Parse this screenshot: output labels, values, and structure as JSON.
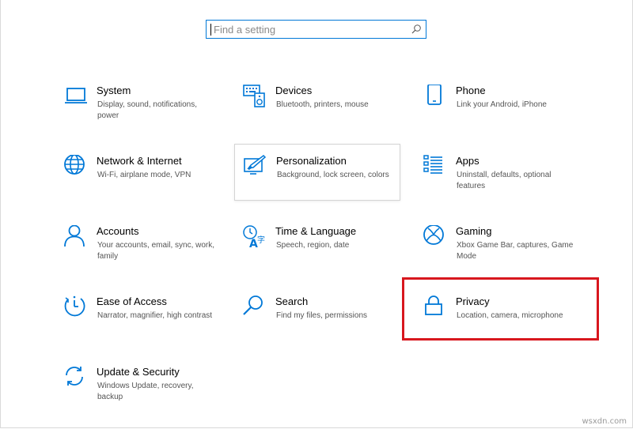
{
  "search": {
    "placeholder": "Find a setting"
  },
  "colors": {
    "accent": "#0078d7",
    "highlight": "#d8171e"
  },
  "tiles": [
    {
      "title": "System",
      "desc": "Display, sound, notifications, power",
      "icon": "laptop-icon"
    },
    {
      "title": "Devices",
      "desc": "Bluetooth, printers, mouse",
      "icon": "keyboard-speaker-icon"
    },
    {
      "title": "Phone",
      "desc": "Link your Android, iPhone",
      "icon": "phone-icon"
    },
    {
      "title": "Network & Internet",
      "desc": "Wi-Fi, airplane mode, VPN",
      "icon": "globe-icon"
    },
    {
      "title": "Personalization",
      "desc": "Background, lock screen, colors",
      "icon": "paintbrush-monitor-icon"
    },
    {
      "title": "Apps",
      "desc": "Uninstall, defaults, optional features",
      "icon": "list-icon"
    },
    {
      "title": "Accounts",
      "desc": "Your accounts, email, sync, work, family",
      "icon": "person-icon"
    },
    {
      "title": "Time & Language",
      "desc": "Speech, region, date",
      "icon": "time-language-icon"
    },
    {
      "title": "Gaming",
      "desc": "Xbox Game Bar, captures, Game Mode",
      "icon": "xbox-icon"
    },
    {
      "title": "Ease of Access",
      "desc": "Narrator, magnifier, high contrast",
      "icon": "ease-of-access-icon"
    },
    {
      "title": "Search",
      "desc": "Find my files, permissions",
      "icon": "magnifier-icon"
    },
    {
      "title": "Privacy",
      "desc": "Location, camera, microphone",
      "icon": "padlock-icon"
    },
    {
      "title": "Update & Security",
      "desc": "Windows Update, recovery, backup",
      "icon": "sync-arrows-icon"
    }
  ],
  "watermark": "wsxdn.com"
}
